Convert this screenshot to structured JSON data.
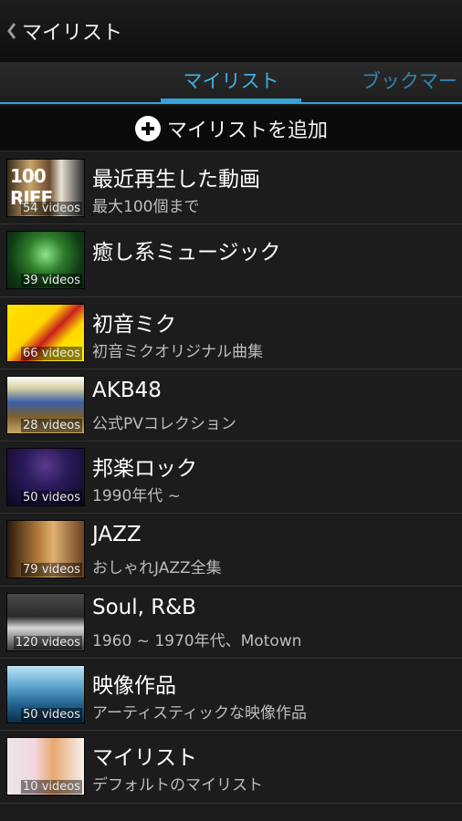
{
  "actionbar": {
    "title": "マイリスト"
  },
  "tabs": [
    {
      "label": "マイリスト",
      "selected": true
    },
    {
      "label": "ブックマー",
      "selected": false
    }
  ],
  "add_button": {
    "label": "マイリストを追加"
  },
  "colors": {
    "accent": "#33a3d8",
    "background": "#1c1c1c"
  },
  "playlists": [
    {
      "title": "最近再生した動画",
      "subtitle": "最大100個まで",
      "count": "54 videos",
      "thumb_text": "100 RIFF"
    },
    {
      "title": "癒し系ミュージック",
      "subtitle": "",
      "count": "39 videos"
    },
    {
      "title": "初音ミク",
      "subtitle": "初音ミクオリジナル曲集",
      "count": "66 videos"
    },
    {
      "title": "AKB48",
      "subtitle": "公式PVコレクション",
      "count": "28 videos"
    },
    {
      "title": "邦楽ロック",
      "subtitle": "1990年代 ~",
      "count": "50 videos"
    },
    {
      "title": "JAZZ",
      "subtitle": "おしゃれJAZZ全集",
      "count": "79 videos"
    },
    {
      "title": "Soul, R&B",
      "subtitle": "1960 ~ 1970年代、Motown",
      "count": "120 videos"
    },
    {
      "title": "映像作品",
      "subtitle": "アーティスティックな映像作品",
      "count": "50 videos"
    },
    {
      "title": "マイリスト",
      "subtitle": "デフォルトのマイリスト",
      "count": "10 videos"
    }
  ]
}
